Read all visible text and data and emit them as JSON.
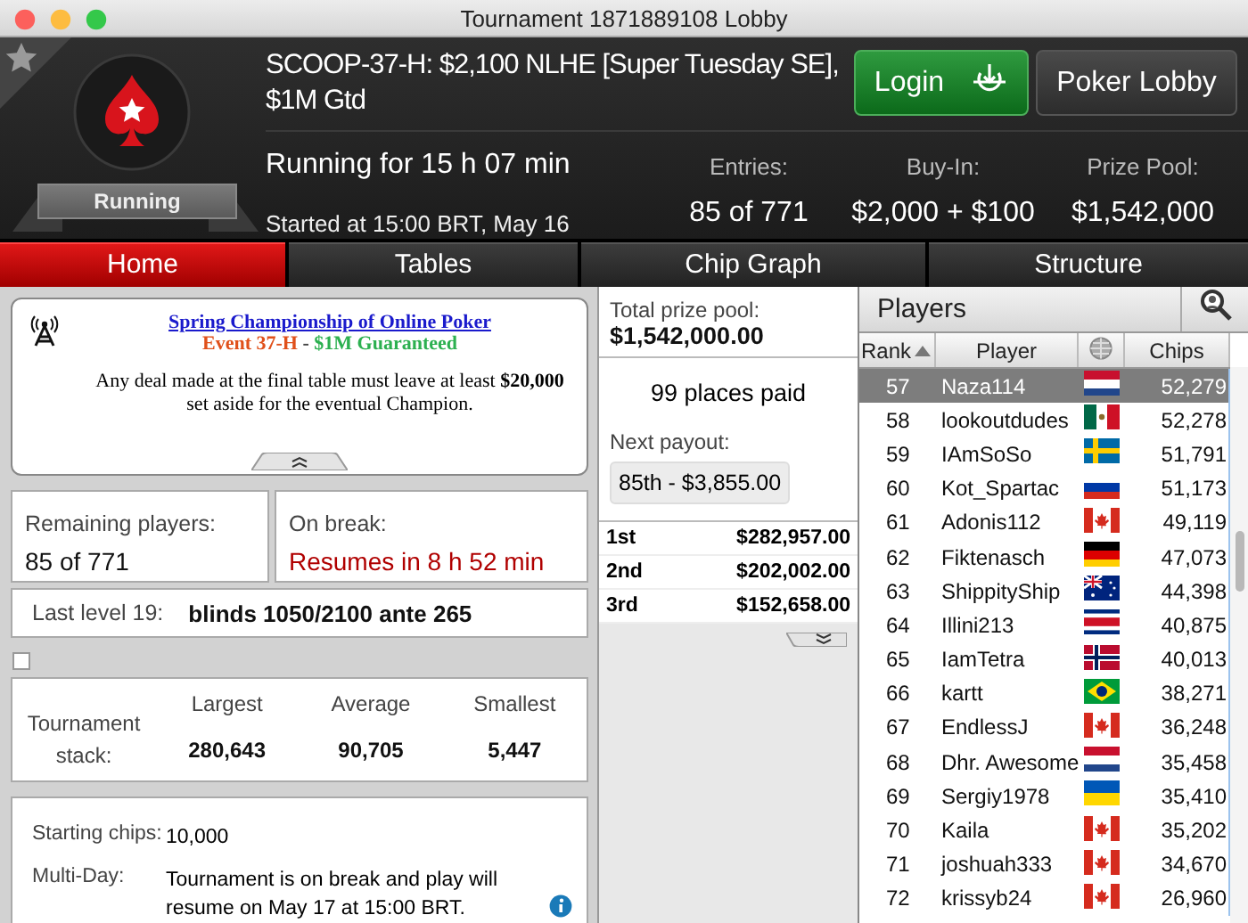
{
  "window": {
    "title": "Tournament 1871889108 Lobby"
  },
  "header": {
    "status": "Running",
    "title": "SCOOP-37-H: $2,100 NLHE [Super Tuesday SE], $1M Gtd",
    "running_for": "Running for 15 h 07 min",
    "started": "Started at 15:00 BRT, May 16",
    "buttons": [
      {
        "label": "Login",
        "kind": "login"
      },
      {
        "label": "Poker Lobby",
        "kind": "plain"
      }
    ],
    "stats": [
      {
        "label": "Entries:",
        "value": "85 of 771"
      },
      {
        "label": "Buy-In:",
        "value": "$2,000 + $100"
      },
      {
        "label": "Prize Pool:",
        "value": "$1,542,000"
      }
    ]
  },
  "tabs": [
    {
      "label": "Home",
      "selected": true
    },
    {
      "label": "Tables",
      "selected": false
    },
    {
      "label": "Chip Graph",
      "selected": false
    },
    {
      "label": "Structure",
      "selected": false
    }
  ],
  "announcement": {
    "title": "Spring Championship of Online Poker",
    "event": "Event 37-H",
    "separator": "-",
    "guarantee": "$1M Guaranteed",
    "message": "Any deal made at the final table must leave at least **$20,000** set aside for the eventual Champion."
  },
  "remaining": {
    "label": "Remaining players:",
    "value": "85 of 771"
  },
  "break": {
    "label": "On break:",
    "value": "Resumes in 8 h 52 min"
  },
  "last_level": {
    "label": "Last level 19:",
    "value": "blinds 1050/2100 ante 265"
  },
  "checkbox": {
    "checked": false
  },
  "stack": {
    "label": "Tournament stack:",
    "columns": [
      "Largest",
      "Average",
      "Smallest"
    ],
    "values": [
      "280,643",
      "90,705",
      "5,447"
    ]
  },
  "details": [
    {
      "label": "Starting chips:",
      "value": "10,000",
      "info": false
    },
    {
      "label": "Multi-Day:",
      "value": "Tournament is on break and play will resume on May 17 at 15:00 BRT.",
      "info": true
    }
  ],
  "prizes": {
    "label": "Total prize pool:",
    "total": "$1,542,000.00",
    "places_paid": "99 places paid",
    "next_label": "Next payout:",
    "next_value": "85th - $3,855.00",
    "payouts": [
      {
        "place": "1st",
        "amount": "$282,957.00"
      },
      {
        "place": "2nd",
        "amount": "$202,002.00"
      },
      {
        "place": "3rd",
        "amount": "$152,658.00"
      }
    ]
  },
  "players": {
    "title": "Players",
    "columns": [
      {
        "kind": "text",
        "label": "Rank",
        "sorted": true
      },
      {
        "kind": "text",
        "label": "Player",
        "sorted": false
      },
      {
        "kind": "globe",
        "sorted": false
      },
      {
        "kind": "text",
        "label": "Chips",
        "sorted": false
      }
    ],
    "rows": [
      {
        "rank": "57",
        "name": "Naza114",
        "kind": "nl",
        "chips": "52,279",
        "selected": true
      },
      {
        "rank": "58",
        "name": "lookoutdudes",
        "kind": "mx",
        "chips": "52,278",
        "selected": false
      },
      {
        "rank": "59",
        "name": "IAmSoSo",
        "kind": "se",
        "chips": "51,791",
        "selected": false
      },
      {
        "rank": "60",
        "name": "Kot_Spartac",
        "kind": "ru",
        "chips": "51,173",
        "selected": false
      },
      {
        "rank": "61",
        "name": "Adonis112",
        "kind": "ca",
        "chips": "49,119",
        "selected": false
      },
      {
        "rank": "62",
        "name": "Fiktenasch",
        "kind": "de",
        "chips": "47,073",
        "selected": false
      },
      {
        "rank": "63",
        "name": "ShippityShip",
        "kind": "au",
        "chips": "44,398",
        "selected": false
      },
      {
        "rank": "64",
        "name": "Illini213",
        "kind": "cr",
        "chips": "40,875",
        "selected": false
      },
      {
        "rank": "65",
        "name": "IamTetra",
        "kind": "no",
        "chips": "40,013",
        "selected": false
      },
      {
        "rank": "66",
        "name": "kartt",
        "kind": "br",
        "chips": "38,271",
        "selected": false
      },
      {
        "rank": "67",
        "name": "EndlessJ",
        "kind": "ca",
        "chips": "36,248",
        "selected": false
      },
      {
        "rank": "68",
        "name": "Dhr. Awesome",
        "kind": "nl",
        "chips": "35,458",
        "selected": false
      },
      {
        "rank": "69",
        "name": "Sergiy1978",
        "kind": "ua",
        "chips": "35,410",
        "selected": false
      },
      {
        "rank": "70",
        "name": "Kaila",
        "kind": "ca",
        "chips": "35,202",
        "selected": false
      },
      {
        "rank": "71",
        "name": "joshuah333",
        "kind": "ca",
        "chips": "34,670",
        "selected": false
      },
      {
        "rank": "72",
        "name": "krissyb24",
        "kind": "ca",
        "chips": "26,960",
        "selected": false
      }
    ]
  }
}
